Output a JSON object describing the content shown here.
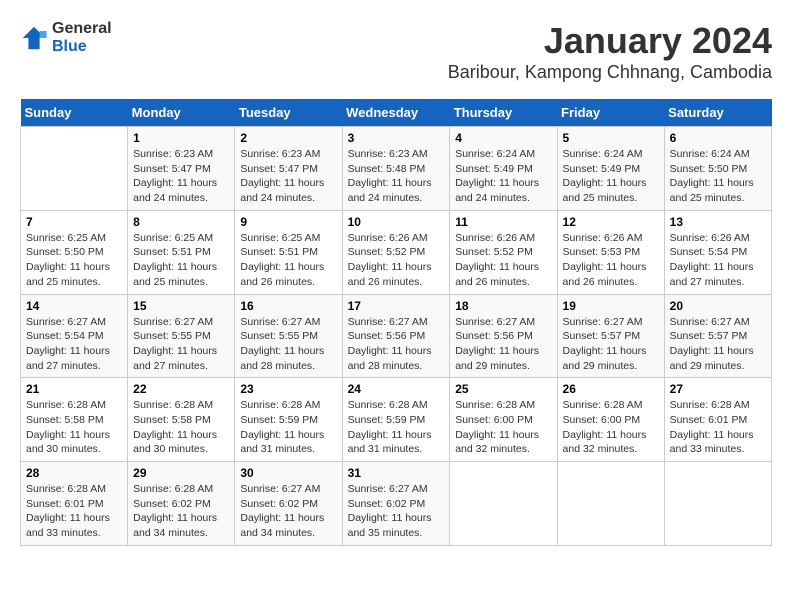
{
  "logo": {
    "line1": "General",
    "line2": "Blue"
  },
  "title": "January 2024",
  "subtitle": "Baribour, Kampong Chhnang, Cambodia",
  "days_of_week": [
    "Sunday",
    "Monday",
    "Tuesday",
    "Wednesday",
    "Thursday",
    "Friday",
    "Saturday"
  ],
  "weeks": [
    [
      {
        "day": "",
        "sunrise": "",
        "sunset": "",
        "daylight": ""
      },
      {
        "day": "1",
        "sunrise": "Sunrise: 6:23 AM",
        "sunset": "Sunset: 5:47 PM",
        "daylight": "Daylight: 11 hours and 24 minutes."
      },
      {
        "day": "2",
        "sunrise": "Sunrise: 6:23 AM",
        "sunset": "Sunset: 5:47 PM",
        "daylight": "Daylight: 11 hours and 24 minutes."
      },
      {
        "day": "3",
        "sunrise": "Sunrise: 6:23 AM",
        "sunset": "Sunset: 5:48 PM",
        "daylight": "Daylight: 11 hours and 24 minutes."
      },
      {
        "day": "4",
        "sunrise": "Sunrise: 6:24 AM",
        "sunset": "Sunset: 5:49 PM",
        "daylight": "Daylight: 11 hours and 24 minutes."
      },
      {
        "day": "5",
        "sunrise": "Sunrise: 6:24 AM",
        "sunset": "Sunset: 5:49 PM",
        "daylight": "Daylight: 11 hours and 25 minutes."
      },
      {
        "day": "6",
        "sunrise": "Sunrise: 6:24 AM",
        "sunset": "Sunset: 5:50 PM",
        "daylight": "Daylight: 11 hours and 25 minutes."
      }
    ],
    [
      {
        "day": "7",
        "sunrise": "Sunrise: 6:25 AM",
        "sunset": "Sunset: 5:50 PM",
        "daylight": "Daylight: 11 hours and 25 minutes."
      },
      {
        "day": "8",
        "sunrise": "Sunrise: 6:25 AM",
        "sunset": "Sunset: 5:51 PM",
        "daylight": "Daylight: 11 hours and 25 minutes."
      },
      {
        "day": "9",
        "sunrise": "Sunrise: 6:25 AM",
        "sunset": "Sunset: 5:51 PM",
        "daylight": "Daylight: 11 hours and 26 minutes."
      },
      {
        "day": "10",
        "sunrise": "Sunrise: 6:26 AM",
        "sunset": "Sunset: 5:52 PM",
        "daylight": "Daylight: 11 hours and 26 minutes."
      },
      {
        "day": "11",
        "sunrise": "Sunrise: 6:26 AM",
        "sunset": "Sunset: 5:52 PM",
        "daylight": "Daylight: 11 hours and 26 minutes."
      },
      {
        "day": "12",
        "sunrise": "Sunrise: 6:26 AM",
        "sunset": "Sunset: 5:53 PM",
        "daylight": "Daylight: 11 hours and 26 minutes."
      },
      {
        "day": "13",
        "sunrise": "Sunrise: 6:26 AM",
        "sunset": "Sunset: 5:54 PM",
        "daylight": "Daylight: 11 hours and 27 minutes."
      }
    ],
    [
      {
        "day": "14",
        "sunrise": "Sunrise: 6:27 AM",
        "sunset": "Sunset: 5:54 PM",
        "daylight": "Daylight: 11 hours and 27 minutes."
      },
      {
        "day": "15",
        "sunrise": "Sunrise: 6:27 AM",
        "sunset": "Sunset: 5:55 PM",
        "daylight": "Daylight: 11 hours and 27 minutes."
      },
      {
        "day": "16",
        "sunrise": "Sunrise: 6:27 AM",
        "sunset": "Sunset: 5:55 PM",
        "daylight": "Daylight: 11 hours and 28 minutes."
      },
      {
        "day": "17",
        "sunrise": "Sunrise: 6:27 AM",
        "sunset": "Sunset: 5:56 PM",
        "daylight": "Daylight: 11 hours and 28 minutes."
      },
      {
        "day": "18",
        "sunrise": "Sunrise: 6:27 AM",
        "sunset": "Sunset: 5:56 PM",
        "daylight": "Daylight: 11 hours and 29 minutes."
      },
      {
        "day": "19",
        "sunrise": "Sunrise: 6:27 AM",
        "sunset": "Sunset: 5:57 PM",
        "daylight": "Daylight: 11 hours and 29 minutes."
      },
      {
        "day": "20",
        "sunrise": "Sunrise: 6:27 AM",
        "sunset": "Sunset: 5:57 PM",
        "daylight": "Daylight: 11 hours and 29 minutes."
      }
    ],
    [
      {
        "day": "21",
        "sunrise": "Sunrise: 6:28 AM",
        "sunset": "Sunset: 5:58 PM",
        "daylight": "Daylight: 11 hours and 30 minutes."
      },
      {
        "day": "22",
        "sunrise": "Sunrise: 6:28 AM",
        "sunset": "Sunset: 5:58 PM",
        "daylight": "Daylight: 11 hours and 30 minutes."
      },
      {
        "day": "23",
        "sunrise": "Sunrise: 6:28 AM",
        "sunset": "Sunset: 5:59 PM",
        "daylight": "Daylight: 11 hours and 31 minutes."
      },
      {
        "day": "24",
        "sunrise": "Sunrise: 6:28 AM",
        "sunset": "Sunset: 5:59 PM",
        "daylight": "Daylight: 11 hours and 31 minutes."
      },
      {
        "day": "25",
        "sunrise": "Sunrise: 6:28 AM",
        "sunset": "Sunset: 6:00 PM",
        "daylight": "Daylight: 11 hours and 32 minutes."
      },
      {
        "day": "26",
        "sunrise": "Sunrise: 6:28 AM",
        "sunset": "Sunset: 6:00 PM",
        "daylight": "Daylight: 11 hours and 32 minutes."
      },
      {
        "day": "27",
        "sunrise": "Sunrise: 6:28 AM",
        "sunset": "Sunset: 6:01 PM",
        "daylight": "Daylight: 11 hours and 33 minutes."
      }
    ],
    [
      {
        "day": "28",
        "sunrise": "Sunrise: 6:28 AM",
        "sunset": "Sunset: 6:01 PM",
        "daylight": "Daylight: 11 hours and 33 minutes."
      },
      {
        "day": "29",
        "sunrise": "Sunrise: 6:28 AM",
        "sunset": "Sunset: 6:02 PM",
        "daylight": "Daylight: 11 hours and 34 minutes."
      },
      {
        "day": "30",
        "sunrise": "Sunrise: 6:27 AM",
        "sunset": "Sunset: 6:02 PM",
        "daylight": "Daylight: 11 hours and 34 minutes."
      },
      {
        "day": "31",
        "sunrise": "Sunrise: 6:27 AM",
        "sunset": "Sunset: 6:02 PM",
        "daylight": "Daylight: 11 hours and 35 minutes."
      },
      {
        "day": "",
        "sunrise": "",
        "sunset": "",
        "daylight": ""
      },
      {
        "day": "",
        "sunrise": "",
        "sunset": "",
        "daylight": ""
      },
      {
        "day": "",
        "sunrise": "",
        "sunset": "",
        "daylight": ""
      }
    ]
  ]
}
